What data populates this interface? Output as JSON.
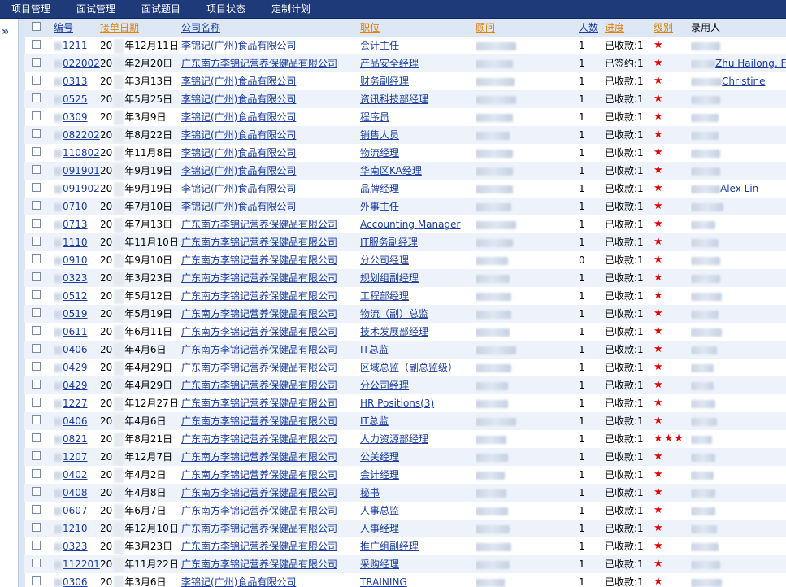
{
  "menu": [
    {
      "label": "项目管理"
    },
    {
      "label": "面试管理"
    },
    {
      "label": "面试题目"
    },
    {
      "label": "项目状态"
    },
    {
      "label": "定制计划"
    }
  ],
  "sidebar": {
    "expand_icon": "double-chevron-right-icon",
    "expand_glyph": "»"
  },
  "columns": {
    "id": "编号",
    "date": "接单日期",
    "company": "公司名称",
    "job": "职位",
    "adviser": "顾问",
    "count": "人数",
    "progress": "进度",
    "level": "级别",
    "recorder": "录用人"
  },
  "colors": {
    "header_bg": "#1f3a78",
    "sort_link": "#e08000",
    "link": "#1a3c9c",
    "star": "#e00000"
  },
  "rows": [
    {
      "id": "1211",
      "date_prefix": "20",
      "date_suffix": "年12月11日",
      "company": "李锦记(广州)食品有限公司",
      "job": "会计主任",
      "count": "1",
      "progress": "已收款:1",
      "stars": "★",
      "extra": ""
    },
    {
      "id": "022002",
      "date_prefix": "20",
      "date_suffix": "年2月20日",
      "company": "广东南方李锦记营养保健品有限公司",
      "job": "产品安全经理",
      "count": "1",
      "progress": "已签约:1",
      "stars": "★",
      "extra": "Zhu Hailong, Fra"
    },
    {
      "id": "0313",
      "date_prefix": "20",
      "date_suffix": "年3月13日",
      "company": "李锦记(广州)食品有限公司",
      "job": "财务副经理",
      "count": "1",
      "progress": "已收款:1",
      "stars": "★",
      "extra": "Christine"
    },
    {
      "id": "0525",
      "date_prefix": "20",
      "date_suffix": "年5月25日",
      "company": "李锦记(广州)食品有限公司",
      "job": "资讯科技部经理",
      "count": "1",
      "progress": "已收款:1",
      "stars": "★",
      "extra": ""
    },
    {
      "id": "0309",
      "date_prefix": "20",
      "date_suffix": "年3月9日",
      "company": "李锦记(广州)食品有限公司",
      "job": "程序员",
      "count": "1",
      "progress": "已收款:1",
      "stars": "★",
      "extra": ""
    },
    {
      "id": "082202",
      "date_prefix": "20",
      "date_suffix": "年8月22日",
      "company": "李锦记(广州)食品有限公司",
      "job": "销售人员",
      "count": "1",
      "progress": "已收款:1",
      "stars": "★",
      "extra": ""
    },
    {
      "id": "110802",
      "date_prefix": "20",
      "date_suffix": "年11月8日",
      "company": "李锦记(广州)食品有限公司",
      "job": "物流经理",
      "count": "1",
      "progress": "已收款:1",
      "stars": "★",
      "extra": ""
    },
    {
      "id": "091901",
      "date_prefix": "20",
      "date_suffix": "年9月19日",
      "company": "李锦记(广州)食品有限公司",
      "job": "华南区KA经理",
      "count": "1",
      "progress": "已收款:1",
      "stars": "★",
      "extra": ""
    },
    {
      "id": "091902",
      "date_prefix": "20",
      "date_suffix": "年9月19日",
      "company": "李锦记(广州)食品有限公司",
      "job": "品牌经理",
      "count": "1",
      "progress": "已收款:1",
      "stars": "★",
      "extra": "Alex Lin"
    },
    {
      "id": "0710",
      "date_prefix": "20",
      "date_suffix": "年7月10日",
      "company": "李锦记(广州)食品有限公司",
      "job": "外事主任",
      "count": "1",
      "progress": "已收款:1",
      "stars": "★",
      "extra": ""
    },
    {
      "id": "0713",
      "date_prefix": "20",
      "date_suffix": "年7月13日",
      "company": "广东南方李锦记营养保健品有限公司",
      "job": "Accounting Manager",
      "count": "1",
      "progress": "已收款:1",
      "stars": "★",
      "extra": ""
    },
    {
      "id": "1110",
      "date_prefix": "20",
      "date_suffix": "年11月10日",
      "company": "广东南方李锦记营养保健品有限公司",
      "job": "IT服务副经理",
      "count": "1",
      "progress": "已收款:1",
      "stars": "★",
      "extra": ""
    },
    {
      "id": "0910",
      "date_prefix": "20",
      "date_suffix": "年9月10日",
      "company": "广东南方李锦记营养保健品有限公司",
      "job": "分公司经理",
      "count": "0",
      "progress": "已收款:1",
      "stars": "★",
      "extra": ""
    },
    {
      "id": "0323",
      "date_prefix": "20",
      "date_suffix": "年3月23日",
      "company": "广东南方李锦记营养保健品有限公司",
      "job": "规划组副经理",
      "count": "1",
      "progress": "已收款:1",
      "stars": "★",
      "extra": ""
    },
    {
      "id": "0512",
      "date_prefix": "20",
      "date_suffix": "年5月12日",
      "company": "广东南方李锦记营养保健品有限公司",
      "job": "工程部经理",
      "count": "1",
      "progress": "已收款:1",
      "stars": "★",
      "extra": ""
    },
    {
      "id": "0519",
      "date_prefix": "20",
      "date_suffix": "年5月19日",
      "company": "广东南方李锦记营养保健品有限公司",
      "job": "物流（副）总监",
      "count": "1",
      "progress": "已收款:1",
      "stars": "★",
      "extra": ""
    },
    {
      "id": "0611",
      "date_prefix": "20",
      "date_suffix": "年6月11日",
      "company": "广东南方李锦记营养保健品有限公司",
      "job": "技术发展部经理",
      "count": "1",
      "progress": "已收款:1",
      "stars": "★",
      "extra": ""
    },
    {
      "id": "0406",
      "date_prefix": "20",
      "date_suffix": "年4月6日",
      "company": "广东南方李锦记营养保健品有限公司",
      "job": "IT总监",
      "count": "1",
      "progress": "已收款:1",
      "stars": "★",
      "extra": ""
    },
    {
      "id": "0429",
      "date_prefix": "20",
      "date_suffix": "年4月29日",
      "company": "广东南方李锦记营养保健品有限公司",
      "job": "区域总监（副总监级）",
      "count": "1",
      "progress": "已收款:1",
      "stars": "★",
      "extra": ""
    },
    {
      "id": "0429",
      "date_prefix": "20",
      "date_suffix": "年4月29日",
      "company": "广东南方李锦记营养保健品有限公司",
      "job": "分公司经理",
      "count": "1",
      "progress": "已收款:1",
      "stars": "★",
      "extra": ""
    },
    {
      "id": "1227",
      "date_prefix": "20",
      "date_suffix": "年12月27日",
      "company": "广东南方李锦记营养保健品有限公司",
      "job": "HR Positions(3)",
      "count": "1",
      "progress": "已收款:1",
      "stars": "★",
      "extra": ""
    },
    {
      "id": "0406",
      "date_prefix": "20",
      "date_suffix": "年4月6日",
      "company": "广东南方李锦记营养保健品有限公司",
      "job": "IT总监",
      "count": "1",
      "progress": "已收款:1",
      "stars": "★",
      "extra": ""
    },
    {
      "id": "0821",
      "date_prefix": "20",
      "date_suffix": "年8月21日",
      "company": "广东南方李锦记营养保健品有限公司",
      "job": "人力资源部经理",
      "count": "1",
      "progress": "已收款:1",
      "stars": "★★★",
      "extra": ""
    },
    {
      "id": "1207",
      "date_prefix": "20",
      "date_suffix": "年12月7日",
      "company": "广东南方李锦记营养保健品有限公司",
      "job": "公关经理",
      "count": "1",
      "progress": "已收款:1",
      "stars": "★",
      "extra": ""
    },
    {
      "id": "0402",
      "date_prefix": "20",
      "date_suffix": "年4月2日",
      "company": "广东南方李锦记营养保健品有限公司",
      "job": "会计经理",
      "count": "1",
      "progress": "已收款:1",
      "stars": "★",
      "extra": ""
    },
    {
      "id": "0408",
      "date_prefix": "20",
      "date_suffix": "年4月8日",
      "company": "广东南方李锦记营养保健品有限公司",
      "job": "秘书",
      "count": "1",
      "progress": "已收款:1",
      "stars": "★",
      "extra": ""
    },
    {
      "id": "0607",
      "date_prefix": "20",
      "date_suffix": "年6月7日",
      "company": "广东南方李锦记营养保健品有限公司",
      "job": "人事总监",
      "count": "1",
      "progress": "已收款:1",
      "stars": "★",
      "extra": ""
    },
    {
      "id": "1210",
      "date_prefix": "20",
      "date_suffix": "年12月10日",
      "company": "广东南方李锦记营养保健品有限公司",
      "job": "人事经理",
      "count": "1",
      "progress": "已收款:1",
      "stars": "★",
      "extra": ""
    },
    {
      "id": "0323",
      "date_prefix": "20",
      "date_suffix": "年3月23日",
      "company": "广东南方李锦记营养保健品有限公司",
      "job": "推广组副经理",
      "count": "1",
      "progress": "已收款:1",
      "stars": "★",
      "extra": ""
    },
    {
      "id": "112201",
      "date_prefix": "20",
      "date_suffix": "年11月22日",
      "company": "广东南方李锦记营养保健品有限公司",
      "job": "采购经理",
      "count": "1",
      "progress": "已收款:1",
      "stars": "★",
      "extra": ""
    },
    {
      "id": "0306",
      "date_prefix": "20",
      "date_suffix": "年3月6日",
      "company": "李锦记(广州)食品有限公司",
      "job": "TRAINING",
      "count": "1",
      "progress": "已收款:1",
      "stars": "★",
      "extra": ""
    }
  ]
}
